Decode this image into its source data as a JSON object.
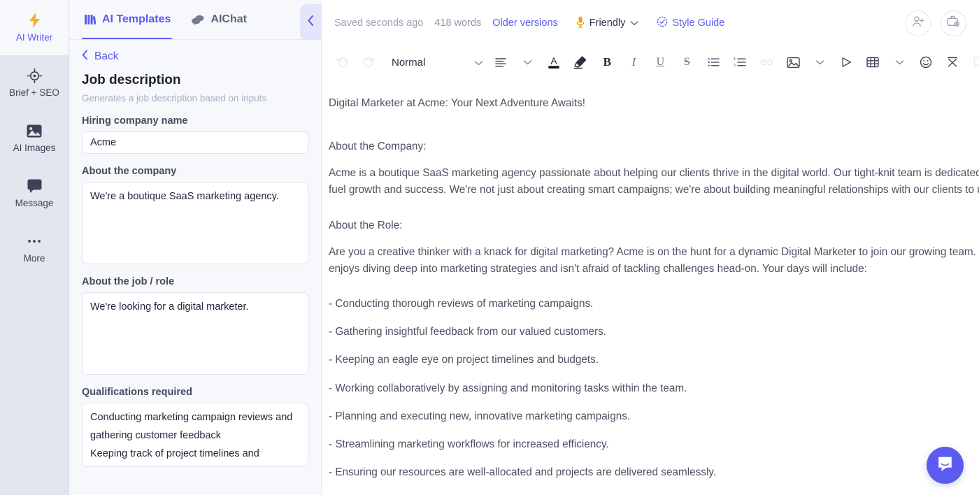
{
  "rail": {
    "items": [
      {
        "label": "AI Writer",
        "icon": "lightning-bolt-icon",
        "active": true
      },
      {
        "label": "Brief + SEO",
        "icon": "target-icon",
        "active": false
      },
      {
        "label": "AI Images",
        "icon": "image-icon",
        "active": false
      },
      {
        "label": "Message",
        "icon": "chat-bubble-icon",
        "active": false
      },
      {
        "label": "More",
        "icon": "ellipsis-icon",
        "active": false
      }
    ]
  },
  "panel": {
    "tabs": [
      {
        "label": "AI Templates",
        "icon": "grid-books-icon",
        "active": true
      },
      {
        "label": "AIChat",
        "icon": "chat-bubbles-icon",
        "active": false
      }
    ],
    "collapse_icon": "chevron-left-icon",
    "back_label": "Back",
    "back_icon": "chevron-left-icon",
    "template_title": "Job description",
    "template_subtitle": "Generates a job description based on inputs",
    "fields": [
      {
        "label": "Hiring company name",
        "type": "input",
        "value": "Acme",
        "placeholder": ""
      },
      {
        "label": "About the company",
        "type": "textarea",
        "value": "We're a boutique SaaS marketing agency.",
        "placeholder": ""
      },
      {
        "label": "About the job / role",
        "type": "textarea",
        "value": "We're looking for a digital marketer.",
        "placeholder": ""
      },
      {
        "label": "Qualifications required",
        "type": "textarea",
        "value": "Conducting marketing campaign reviews and gathering customer feedback\nKeeping track of project timelines and",
        "placeholder": ""
      }
    ]
  },
  "editor": {
    "status": {
      "saved_text": "Saved seconds ago",
      "word_count": "418 words",
      "older_versions": "Older versions",
      "tone_label": "Friendly",
      "tone_icon": "microphone-icon",
      "tone_caret_icon": "chevron-down-icon",
      "style_guide": "Style Guide",
      "style_guide_icon": "check-badge-icon"
    },
    "top_right_buttons": [
      {
        "name": "invite-collaborator-button",
        "icon": "person-plus-icon"
      },
      {
        "name": "document-settings-button",
        "icon": "briefcase-gear-icon"
      }
    ],
    "toolbar": [
      {
        "name": "undo-button",
        "icon": "undo-icon",
        "label": "",
        "disabled": true
      },
      {
        "name": "redo-button",
        "icon": "redo-icon",
        "label": "",
        "disabled": true
      },
      {
        "name": "paragraph-style-select",
        "icon": "chevron-down-icon",
        "label": "Normal",
        "disabled": false
      },
      {
        "name": "align-button",
        "icon": "align-left-icon",
        "label": "",
        "disabled": false
      },
      {
        "name": "align-caret",
        "icon": "chevron-down-icon",
        "label": "",
        "disabled": false
      },
      {
        "name": "text-color-button",
        "icon": "text-color-a-icon",
        "label": "",
        "disabled": false
      },
      {
        "name": "highlight-button",
        "icon": "highlighter-icon",
        "label": "",
        "disabled": false
      },
      {
        "name": "bold-button",
        "icon": "bold-icon",
        "label": "B",
        "disabled": false
      },
      {
        "name": "italic-button",
        "icon": "italic-icon",
        "label": "I",
        "disabled": false
      },
      {
        "name": "underline-button",
        "icon": "underline-icon",
        "label": "U",
        "disabled": false
      },
      {
        "name": "strikethrough-button",
        "icon": "strikethrough-icon",
        "label": "S",
        "disabled": false
      },
      {
        "name": "bullet-list-button",
        "icon": "bullet-list-icon",
        "label": "",
        "disabled": false
      },
      {
        "name": "numbered-list-button",
        "icon": "numbered-list-icon",
        "label": "",
        "disabled": false
      },
      {
        "name": "link-button",
        "icon": "link-icon",
        "label": "",
        "disabled": true
      },
      {
        "name": "insert-image-button",
        "icon": "image-icon",
        "label": "",
        "disabled": false
      },
      {
        "name": "insert-image-caret",
        "icon": "chevron-down-icon",
        "label": "",
        "disabled": false
      },
      {
        "name": "insert-video-button",
        "icon": "play-triangle-icon",
        "label": "",
        "disabled": false
      },
      {
        "name": "insert-table-button",
        "icon": "table-icon",
        "label": "",
        "disabled": false
      },
      {
        "name": "insert-table-caret",
        "icon": "chevron-down-icon",
        "label": "",
        "disabled": false
      },
      {
        "name": "emoji-button",
        "icon": "smiley-icon",
        "label": "",
        "disabled": false
      },
      {
        "name": "clear-formatting-button",
        "icon": "clear-format-icon",
        "label": "",
        "disabled": false
      },
      {
        "name": "add-comment-button",
        "icon": "comment-plus-icon",
        "label": "",
        "disabled": true
      },
      {
        "name": "edit-pencil-button",
        "icon": "pencil-icon",
        "label": "",
        "disabled": false
      }
    ],
    "document": [
      {
        "text": "Digital Marketer at Acme: Your Next Adventure Awaits!",
        "style": "spacer-after"
      },
      {
        "text": "About the Company:",
        "style": "tight"
      },
      {
        "text": "Acme is a boutique SaaS marketing agency passionate about helping our clients thrive in the digital world. Our tight-knit team is dedicated to providing innovative solutions that fuel growth and success. We're not just about creating smart campaigns; we're about building meaningful relationships with our clients to unlock their full potential.",
        "style": "block"
      },
      {
        "text": "About the Role:",
        "style": "tight"
      },
      {
        "text": "Are you a creative thinker with a knack for digital marketing? Acme is on the hunt for a dynamic Digital Marketer to join our growing team. This role is perfect for someone who enjoys diving deep into marketing strategies and isn't afraid of tackling challenges head-on. Your days will include:",
        "style": "block"
      },
      {
        "text": "- Conducting thorough reviews of marketing campaigns.",
        "style": "bullet"
      },
      {
        "text": "- Gathering insightful feedback from our valued customers.",
        "style": "bullet"
      },
      {
        "text": "- Keeping an eagle eye on project timelines and budgets.",
        "style": "bullet"
      },
      {
        "text": "- Working collaboratively by assigning and monitoring tasks within the team.",
        "style": "bullet"
      },
      {
        "text": "- Planning and executing new, innovative marketing campaigns.",
        "style": "bullet"
      },
      {
        "text": "- Streamlining marketing workflows for increased efficiency.",
        "style": "bullet"
      },
      {
        "text": "- Ensuring our resources are well-allocated and projects are delivered seamlessly.",
        "style": "bullet"
      }
    ],
    "intercom_icon": "intercom-messenger-icon"
  },
  "colors": {
    "accent": "#5b5bf0",
    "rail_bg": "#e3e6ef",
    "panel_bg": "#f7f8fc",
    "doc_text": "#4b5161",
    "muted": "#9aa0b1",
    "tone_icon": "#e8a317"
  }
}
